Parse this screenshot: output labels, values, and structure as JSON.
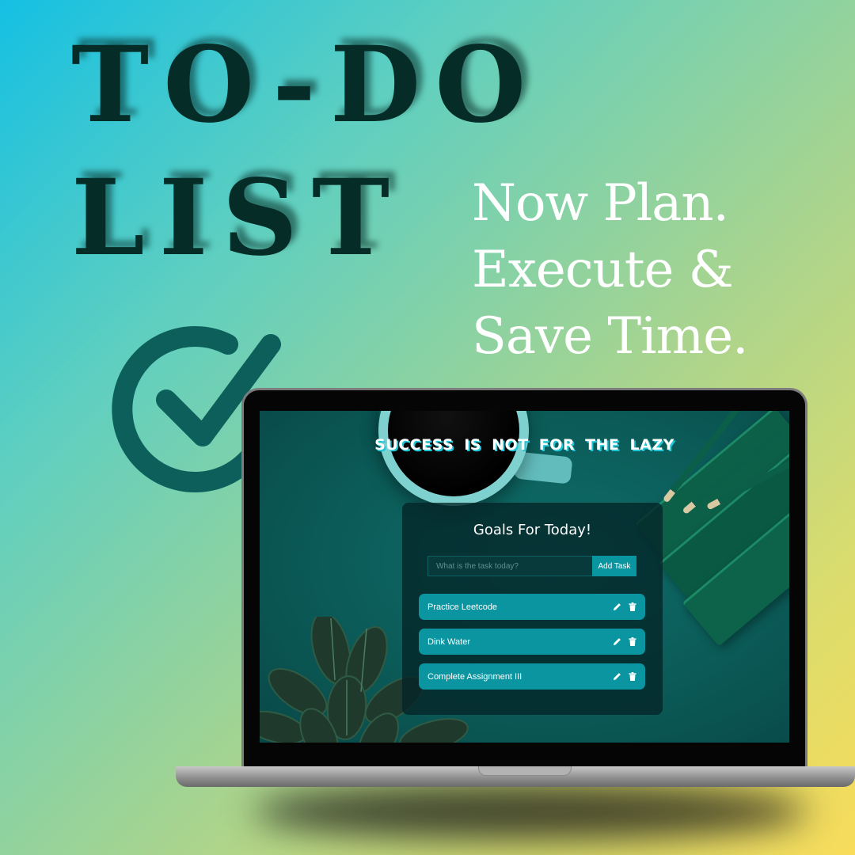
{
  "poster": {
    "headline_line_1": "TO-DO",
    "headline_line_2": "LIST",
    "tagline": [
      "Now Plan.",
      "Execute &",
      "Save Time."
    ],
    "icons": [
      "check-circle-icon"
    ],
    "colors": {
      "headline": "#062c27",
      "check": "#0c5f5a",
      "tagline": "#ffffff"
    }
  },
  "app": {
    "motto": "SUCCESS IS NOT FOR THE LAZY",
    "panel_title": "Goals For Today!",
    "task_input": {
      "value": "",
      "placeholder": "What is the task today?"
    },
    "add_button_label": "Add Task",
    "tasks": [
      {
        "text": "Practice Leetcode",
        "icons": [
          "pencil-icon",
          "trash-icon"
        ]
      },
      {
        "text": "Dink Water",
        "icons": [
          "pencil-icon",
          "trash-icon"
        ]
      },
      {
        "text": "Complete Assignment III",
        "icons": [
          "pencil-icon",
          "trash-icon"
        ]
      }
    ],
    "colors": {
      "panel": "#042426",
      "task_bg": "#0a95a0",
      "button": "#0a96a0",
      "motto_shadow": "#1ec7d8"
    }
  }
}
